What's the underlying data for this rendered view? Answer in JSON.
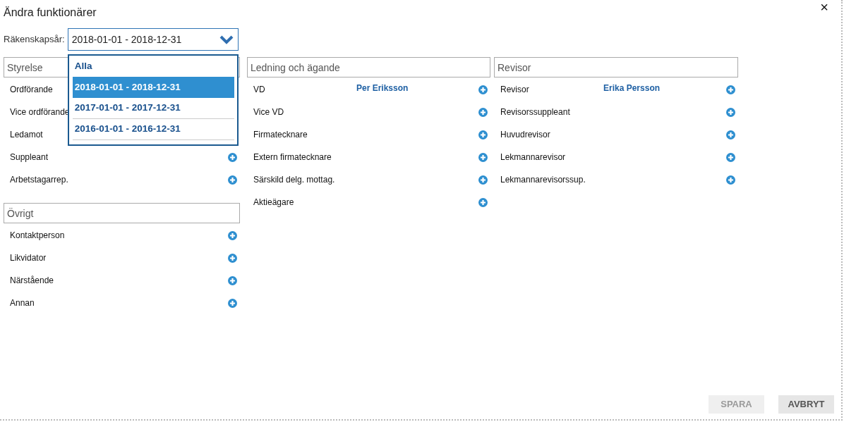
{
  "window": {
    "title": "Ändra funktionärer",
    "close": "×"
  },
  "fiscal_year": {
    "label": "Räkenskapsår:",
    "value": "2018-01-01 - 2018-12-31",
    "expanded": true,
    "options": [
      {
        "label": "Alla",
        "selected": false
      },
      {
        "label": "2018-01-01 - 2018-12-31",
        "selected": true
      },
      {
        "label": "2017-01-01 - 2017-12-31",
        "selected": false
      },
      {
        "label": "2016-01-01 - 2016-12-31",
        "selected": false
      }
    ]
  },
  "columns": [
    {
      "sections": [
        {
          "title": "Styrelse",
          "roles": [
            {
              "label": "Ordförande",
              "add": false
            },
            {
              "label": "Vice ordförande",
              "add": false
            },
            {
              "label": "Ledamot",
              "add": false
            },
            {
              "label": "Suppleant",
              "add": true
            },
            {
              "label": "Arbetstagarrep.",
              "add": true
            }
          ]
        },
        {
          "title": "Övrigt",
          "roles": [
            {
              "label": "Kontaktperson",
              "add": true
            },
            {
              "label": "Likvidator",
              "add": true
            },
            {
              "label": "Närstående",
              "add": true
            },
            {
              "label": "Annan",
              "add": true
            }
          ]
        }
      ]
    },
    {
      "sections": [
        {
          "title": "Ledning och ägande",
          "roles": [
            {
              "label": "VD",
              "person": "Per Eriksson",
              "add": true
            },
            {
              "label": "Vice VD",
              "add": true
            },
            {
              "label": "Firmatecknare",
              "add": true
            },
            {
              "label": "Extern firmatecknare",
              "add": true
            },
            {
              "label": "Särskild delg. mottag.",
              "add": true
            },
            {
              "label": "Aktieägare",
              "add": true
            }
          ]
        }
      ]
    },
    {
      "sections": [
        {
          "title": "Revisor",
          "roles": [
            {
              "label": "Revisor",
              "person": "Erika Persson",
              "add": true
            },
            {
              "label": "Revisorssuppleant",
              "add": true
            },
            {
              "label": "Huvudrevisor",
              "add": true
            },
            {
              "label": "Lekmannarevisor",
              "add": true
            },
            {
              "label": "Lekmannarevisorssup.",
              "add": true
            }
          ]
        }
      ]
    }
  ],
  "buttons": [
    {
      "label": "SPARA",
      "disabled": true
    },
    {
      "label": "AVBRYT",
      "disabled": false
    }
  ]
}
